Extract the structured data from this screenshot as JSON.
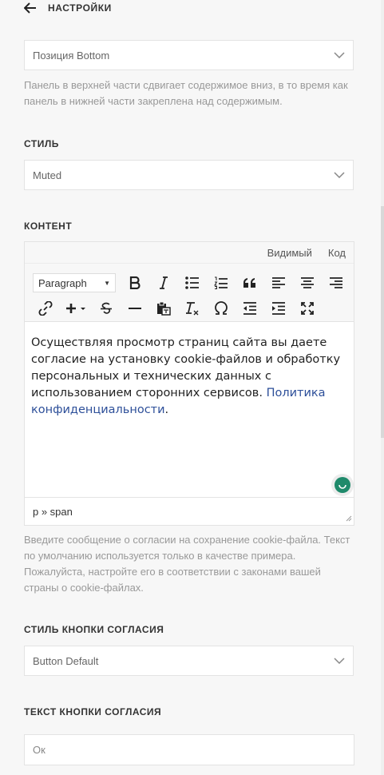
{
  "header": {
    "title": "НАСТРОЙКИ",
    "back_icon": "arrow-left-icon"
  },
  "position": {
    "value": "Позиция Bottom",
    "help": "Панель в верхней части сдвигает содержимое вниз, в то время как панель в нижней части закреплена над содержимым."
  },
  "style": {
    "label": "СТИЛЬ",
    "value": "Muted"
  },
  "content": {
    "label": "КОНТЕНТ",
    "tabs": {
      "visual": "Видимый",
      "code": "Код"
    },
    "format_select": "Paragraph",
    "text": "Осуществляя просмотр страниц сайта вы даете согласие на установку cookie-файлов и обработку персональных и технических данных с использованием сторонних сервисов.",
    "link_text": "Политика конфиденциальности",
    "trailing": ".",
    "path": "p » span",
    "help": "Введите сообщение о согласии на сохранение cookie-файла. Текст по умолчанию используется только в качестве примера. Пожалуйста, настройте его в соответствии с законами вашей страны о cookie-файлах."
  },
  "button_style": {
    "label": "СТИЛЬ КНОПКИ СОГЛАСИЯ",
    "value": "Button Default"
  },
  "button_text": {
    "label": "ТЕКСТ КНОПКИ СОГЛАСИЯ",
    "value": "Ок"
  },
  "toolbar_icons": [
    "bold-icon",
    "italic-icon",
    "bullet-list-icon",
    "numbered-list-icon",
    "blockquote-icon",
    "align-left-icon",
    "align-center-icon",
    "align-right-icon",
    "link-icon",
    "insert-icon",
    "strikethrough-icon",
    "horizontal-rule-icon",
    "paste-text-icon",
    "clear-formatting-icon",
    "special-character-icon",
    "outdent-icon",
    "indent-icon",
    "fullscreen-icon"
  ],
  "colors": {
    "link": "#2d4f99",
    "badge": "#1f8a6b"
  }
}
